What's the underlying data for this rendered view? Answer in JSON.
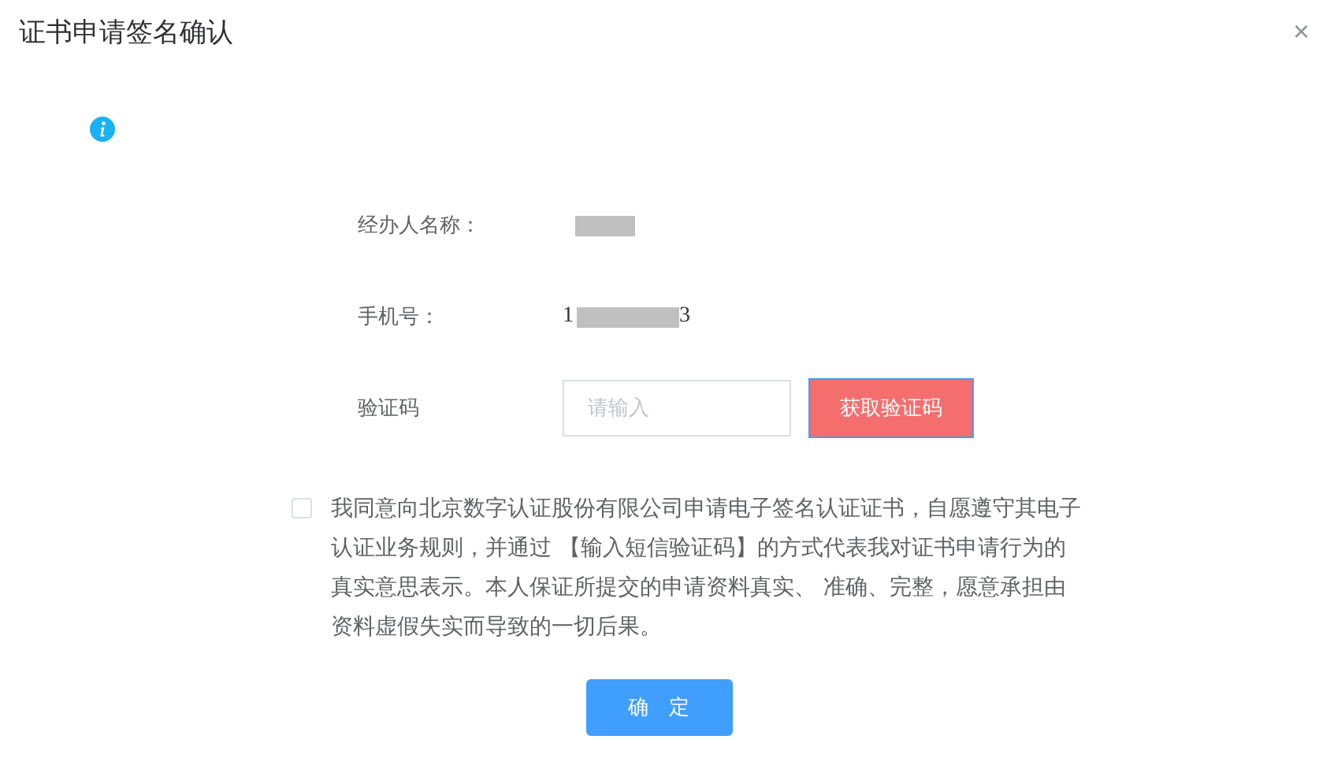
{
  "dialog": {
    "title": "证书申请签名确认",
    "close": "×"
  },
  "info": {
    "kind": "info"
  },
  "fields": [
    {
      "kind": "text",
      "label": "经办人名称：",
      "redacted": true
    },
    {
      "kind": "text",
      "label": "手机号：",
      "prefix": "1",
      "suffix": "3",
      "redacted": true
    },
    {
      "kind": "code",
      "label": "验证码",
      "placeholder": "请输入",
      "button": "获取验证码"
    }
  ],
  "agreement": {
    "checked": false,
    "text": "我同意向北京数字认证股份有限公司申请电子签名认证证书，自愿遵守其电子认证业务规则，并通过 【输入短信验证码】的方式代表我对证书申请行为的真实意思表示。本人保证所提交的申请资料真实、 准确、完整，愿意承担由资料虚假失实而导致的一切后果。"
  },
  "confirm": "确　定"
}
